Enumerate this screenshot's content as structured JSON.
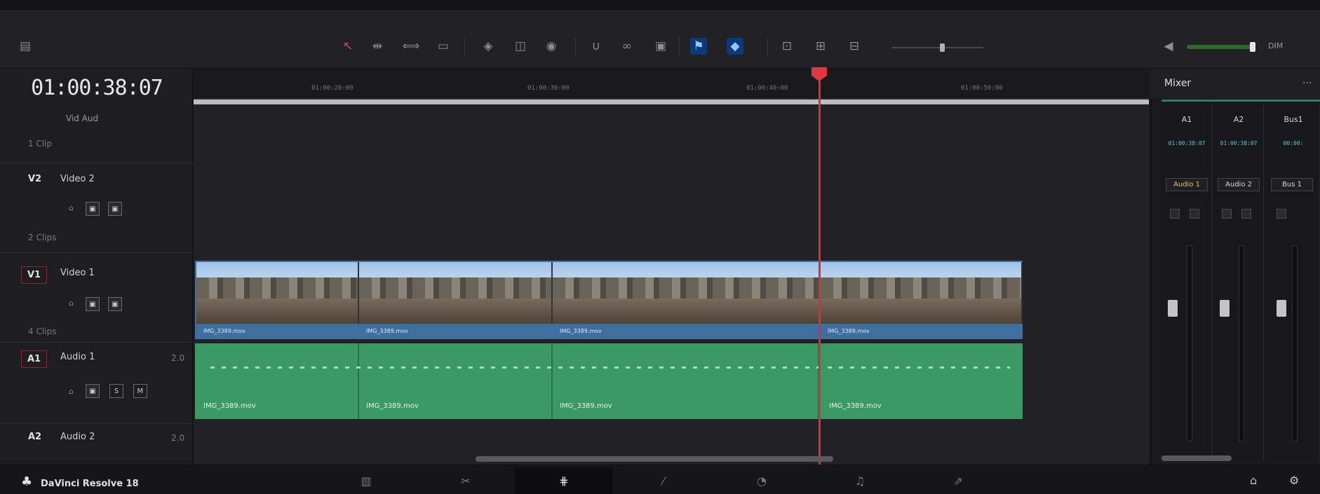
{
  "app": {
    "name": "DaVinci Resolve 18"
  },
  "toolbar": {
    "left_icon": "layout-icon",
    "tools": [
      "pointer-icon",
      "trim-icon",
      "dynamic-trim-icon",
      "blade-icon",
      "insert-icon",
      "overwrite-icon",
      "replace-icon",
      "snap-icon",
      "link-icon",
      "lock-icon",
      "flag-icon",
      "marker-icon",
      "zoom-fit-icon",
      "zoom-detail-icon",
      "zoom-custom-icon"
    ],
    "volume_label": "DIM"
  },
  "timeline": {
    "timecode": "01:00:38:07",
    "ruler_labels": [
      "01:00:20:00",
      "01:00:30:00",
      "01:00:40:00",
      "01:00:50:00"
    ],
    "tracks": {
      "v2": {
        "id": "V2",
        "name": "Video 2",
        "clips": "1 Clip"
      },
      "v1": {
        "id": "V1",
        "name": "Video 1",
        "clips": "2 Clips"
      },
      "a1": {
        "id": "A1",
        "name": "Audio 1",
        "clips": "4 Clips",
        "level": "2.0"
      },
      "a2": {
        "id": "A2",
        "name": "Audio 2",
        "level": "2.0"
      }
    },
    "header_sub": "Vid  Aud",
    "video_clips": [
      "IMG_3389.mov",
      "IMG_3389.mov",
      "IMG_3389.mov",
      "IMG_3389.mov"
    ],
    "audio_clips": [
      "IMG_3389.mov",
      "IMG_3389.mov",
      "IMG_3389.mov",
      "IMG_3389.mov"
    ]
  },
  "mixer": {
    "title": "Mixer",
    "more": "···",
    "channels": [
      {
        "label": "A1",
        "tc": "01:00:38:07",
        "name": "Audio 1"
      },
      {
        "label": "A2",
        "tc": "01:00:38:07",
        "name": "Audio 2"
      },
      {
        "label": "Bus1",
        "tc": "00:00:",
        "name": "Bus 1"
      }
    ]
  },
  "bottom": {
    "pages": [
      "media-icon",
      "cut-icon",
      "edit-icon",
      "fusion-icon",
      "color-icon",
      "fairlight-icon",
      "deliver-icon"
    ],
    "active_page": 2
  },
  "colors": {
    "playhead": "#d6313a",
    "video_clip": "#3f6f9f",
    "audio_clip": "#3b9a63"
  }
}
